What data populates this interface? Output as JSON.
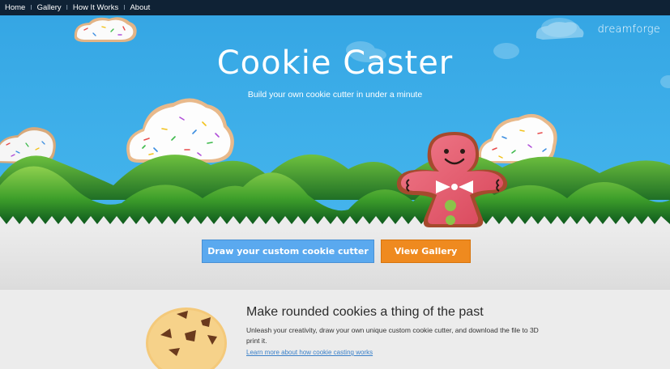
{
  "nav": {
    "items": [
      "Home",
      "Gallery",
      "How It Works",
      "About"
    ],
    "separator": "I"
  },
  "hero": {
    "brand": "dreamforge",
    "title": "Cookie Caster",
    "subtitle": "Build your own cookie cutter in under a minute"
  },
  "actions": {
    "draw_label": "Draw your custom cookie cutter",
    "gallery_label": "View Gallery"
  },
  "feature": {
    "title": "Make rounded cookies a thing of the past",
    "text": "Unleash your creativity, draw your own unique custom cookie cutter, and download the file to 3D print it.",
    "link_text": "Learn more about how cookie casting works"
  },
  "colors": {
    "sky": "#3fb0ea",
    "nav_bg": "#0f2235",
    "draw_button": "#5aa9ef",
    "gallery_button": "#ef8a1f",
    "mountain": "#5fb832"
  },
  "icons": [
    "cloud-cookie-icon",
    "gingerbread-man-icon",
    "chocolate-chip-cookie-icon"
  ]
}
